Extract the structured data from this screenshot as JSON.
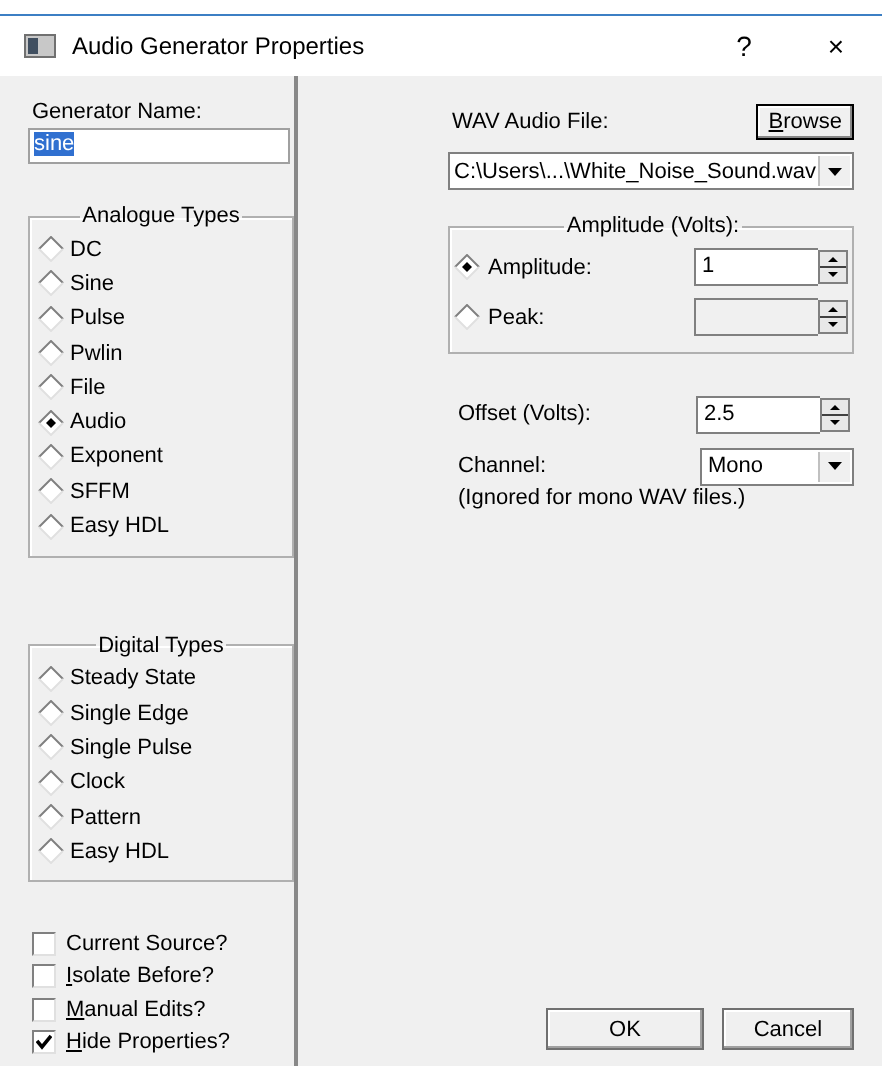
{
  "window": {
    "title": "Audio Generator Properties",
    "help": "?",
    "close": "×"
  },
  "generator_name": {
    "label": "Generator Name:",
    "value": "sine",
    "selected": true
  },
  "analogue_types": {
    "title": "Analogue Types",
    "items": [
      {
        "label": "DC",
        "selected": false
      },
      {
        "label": "Sine",
        "selected": false
      },
      {
        "label": "Pulse",
        "selected": false
      },
      {
        "label": "Pwlin",
        "selected": false
      },
      {
        "label": "File",
        "selected": false
      },
      {
        "label": "Audio",
        "selected": true
      },
      {
        "label": "Exponent",
        "selected": false
      },
      {
        "label": "SFFM",
        "selected": false
      },
      {
        "label": "Easy HDL",
        "selected": false
      }
    ]
  },
  "digital_types": {
    "title": "Digital Types",
    "items": [
      {
        "label": "Steady State",
        "selected": false
      },
      {
        "label": "Single Edge",
        "selected": false
      },
      {
        "label": "Single Pulse",
        "selected": false
      },
      {
        "label": "Clock",
        "selected": false
      },
      {
        "label": "Pattern",
        "selected": false
      },
      {
        "label": "Easy HDL",
        "selected": false
      }
    ]
  },
  "options": [
    {
      "label": "Current Source?",
      "checked": false,
      "access_key_underlined": false
    },
    {
      "label": "Isolate Before?",
      "checked": false,
      "access_key_underlined": true
    },
    {
      "label": "Manual Edits?",
      "checked": false,
      "access_key_underlined": true
    },
    {
      "label": "Hide Properties?",
      "checked": true,
      "access_key_underlined": true
    }
  ],
  "wav_file": {
    "label": "WAV Audio File:",
    "browse": {
      "label": "Browse",
      "access_key_underlined": true
    },
    "value": "C:\\Users\\...\\White_Noise_Sound.wav"
  },
  "amplitude_group": {
    "title": "Amplitude (Volts):",
    "rows": [
      {
        "label": "Amplitude:",
        "selected": true,
        "value": "1",
        "disabled": false
      },
      {
        "label": "Peak:",
        "selected": false,
        "disabled": true
      }
    ]
  },
  "offset": {
    "label": "Offset (Volts):",
    "value": "2.5"
  },
  "channel": {
    "label": "Channel:",
    "value": "Mono",
    "note": "(Ignored for mono WAV files.)"
  },
  "buttons": [
    {
      "label": "OK"
    },
    {
      "label": "Cancel"
    }
  ]
}
